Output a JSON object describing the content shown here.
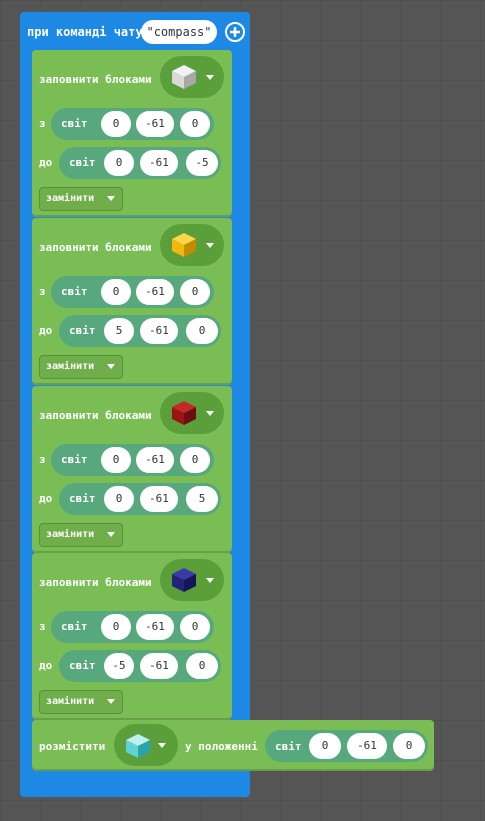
{
  "event": {
    "label": "при команді чату",
    "command": "compass"
  },
  "fill_blocks": [
    {
      "label": "заповнити блоками",
      "block_icon": "white-cube-icon",
      "block_color": "#d9d9d9",
      "from_label": "з",
      "to_label": "до",
      "from": {
        "world": "світ",
        "x": "0",
        "y": "-61",
        "z": "0"
      },
      "to": {
        "world": "світ",
        "x": "0",
        "y": "-61",
        "z": "-5"
      },
      "mode": "замінити"
    },
    {
      "label": "заповнити блоками",
      "block_icon": "gold-cube-icon",
      "block_color": "#f2b90c",
      "from_label": "з",
      "to_label": "до",
      "from": {
        "world": "світ",
        "x": "0",
        "y": "-61",
        "z": "0"
      },
      "to": {
        "world": "світ",
        "x": "5",
        "y": "-61",
        "z": "0"
      },
      "mode": "замінити"
    },
    {
      "label": "заповнити блоками",
      "block_icon": "red-cube-icon",
      "block_color": "#9b1414",
      "from_label": "з",
      "to_label": "до",
      "from": {
        "world": "світ",
        "x": "0",
        "y": "-61",
        "z": "0"
      },
      "to": {
        "world": "світ",
        "x": "0",
        "y": "-61",
        "z": "5"
      },
      "mode": "замінити"
    },
    {
      "label": "заповнити блоками",
      "block_icon": "blue-cube-icon",
      "block_color": "#23237a",
      "from_label": "з",
      "to_label": "до",
      "from": {
        "world": "світ",
        "x": "0",
        "y": "-61",
        "z": "0"
      },
      "to": {
        "world": "світ",
        "x": "-5",
        "y": "-61",
        "z": "0"
      },
      "mode": "замінити"
    }
  ],
  "place": {
    "label": "розмістити",
    "block_icon": "diamond-cube-icon",
    "block_color": "#5fd3d3",
    "at_label": "у положенні",
    "pos": {
      "world": "світ",
      "x": "0",
      "y": "-61",
      "z": "0"
    }
  },
  "colors": {
    "event_block": "#1e88e5",
    "blocks_category": "#7bbd55",
    "position_block": "#58a87e",
    "background": "#555555"
  }
}
